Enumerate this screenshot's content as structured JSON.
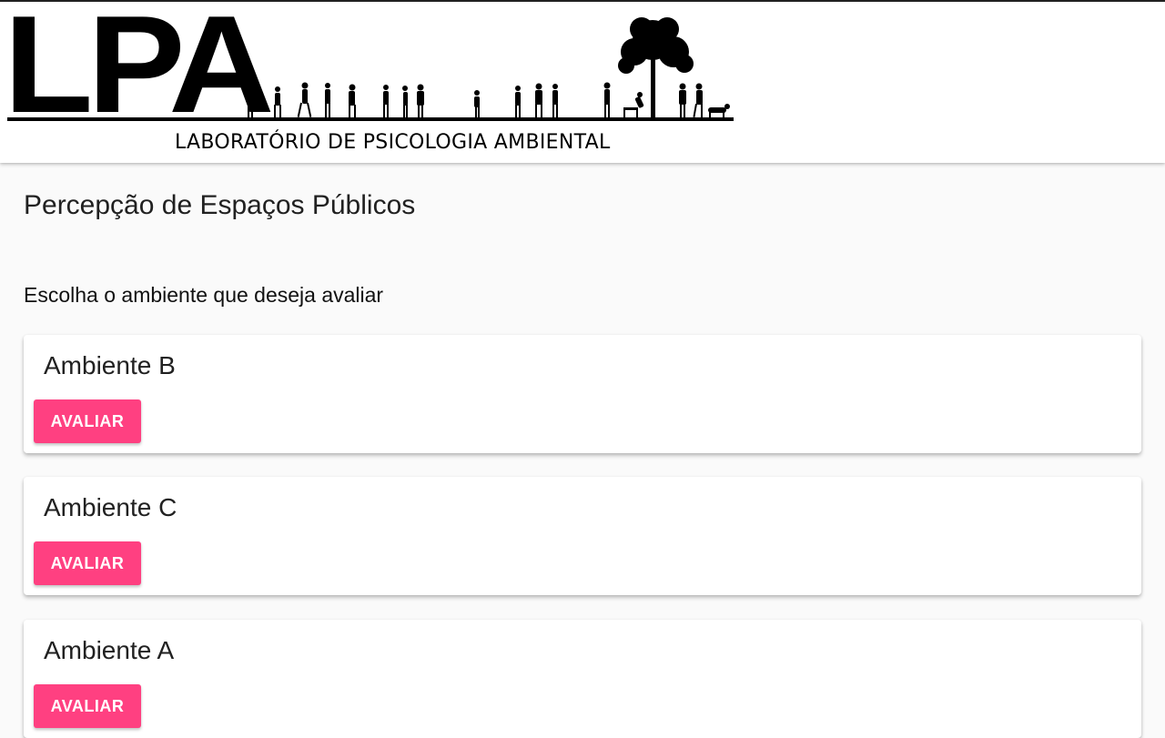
{
  "header": {
    "logo_letters": "LPA",
    "logo_subtitle": "LABORATÓRIO DE PSICOLOGIA AMBIENTAL"
  },
  "main": {
    "page_title": "Percepção de Espaços Públicos",
    "prompt": "Escolha o ambiente que deseja avaliar",
    "cards": [
      {
        "title": "Ambiente B",
        "button_label": "AVALIAR"
      },
      {
        "title": "Ambiente C",
        "button_label": "AVALIAR"
      },
      {
        "title": "Ambiente A",
        "button_label": "AVALIAR"
      }
    ]
  },
  "colors": {
    "accent": "#ff4081",
    "header_background": "#ffffff",
    "page_background": "#fafafa"
  }
}
